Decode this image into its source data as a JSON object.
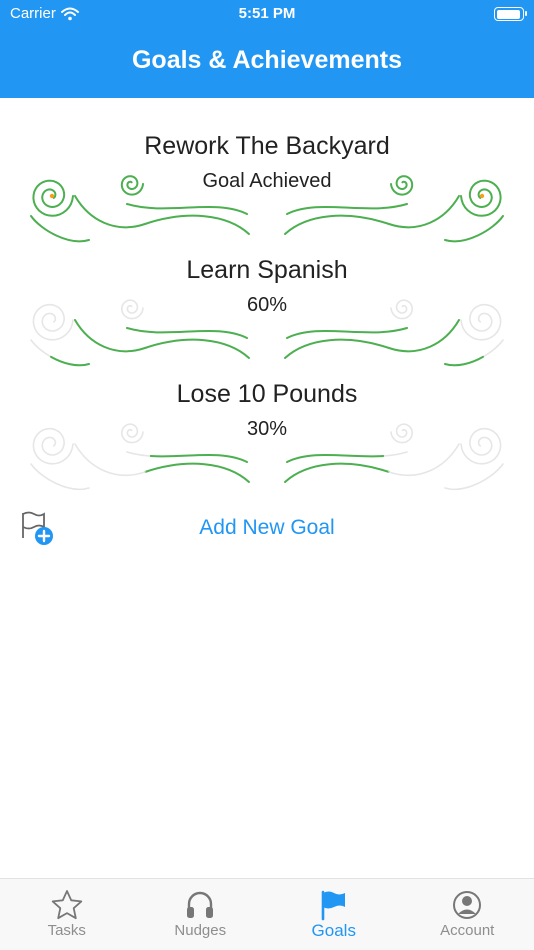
{
  "status_bar": {
    "carrier": "Carrier",
    "time": "5:51 PM"
  },
  "header": {
    "title": "Goals & Achievements"
  },
  "goals": [
    {
      "title": "Rework The Backyard",
      "status": "Goal Achieved",
      "progress": 1.0
    },
    {
      "title": "Learn Spanish",
      "status": "60%",
      "progress": 0.6
    },
    {
      "title": "Lose 10 Pounds",
      "status": "30%",
      "progress": 0.3
    }
  ],
  "add_goal": {
    "label": "Add New Goal",
    "icon": "flag-plus-icon"
  },
  "tabs": [
    {
      "label": "Tasks",
      "icon": "star-icon",
      "active": false
    },
    {
      "label": "Nudges",
      "icon": "headphones-icon",
      "active": false
    },
    {
      "label": "Goals",
      "icon": "flag-icon",
      "active": true
    },
    {
      "label": "Account",
      "icon": "person-icon",
      "active": false
    }
  ],
  "colors": {
    "accent": "#2196f3",
    "progress": "#4caf50",
    "track": "#e6e6e6",
    "inactive_tab": "#8e8e8e"
  }
}
